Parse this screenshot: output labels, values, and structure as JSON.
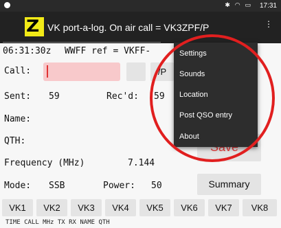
{
  "status_bar": {
    "icons": "✱ ◠ ▭",
    "time": "17:31"
  },
  "app_bar": {
    "logo_letter": "Z",
    "title": "VK port-a-log. On air call = VK3ZPF/P"
  },
  "header": {
    "utc_time": "06:31:30z",
    "ref_text": "WWFF ref = VKFF-"
  },
  "form": {
    "call_label": "Call:",
    "call_value": "",
    "slash_p": "/P",
    "sent_label": "Sent:",
    "sent_value": "59",
    "recd_label": "Rec'd:",
    "recd_value": "59",
    "name_label": "Name:",
    "qth_label": "QTH:",
    "freq_label": "Frequency (MHz)",
    "freq_value": "7.144",
    "mode_label": "Mode:",
    "mode_value": "SSB",
    "power_label": "Power:",
    "power_value": "50",
    "save_label": "Save",
    "summary_label": "Summary"
  },
  "vk_buttons": [
    "VK1",
    "VK2",
    "VK3",
    "VK4",
    "VK5",
    "VK6",
    "VK7",
    "VK8"
  ],
  "log_header": "TIME CALL     MHz    TX  RX  NAME     QTH",
  "menu": {
    "items": [
      "Settings",
      "Sounds",
      "Location",
      "Post QSO entry",
      "About"
    ]
  },
  "colors": {
    "highlight_circle": "#e11f1f",
    "logo": "#f2ea17",
    "call_field": "#f8c9cb"
  }
}
